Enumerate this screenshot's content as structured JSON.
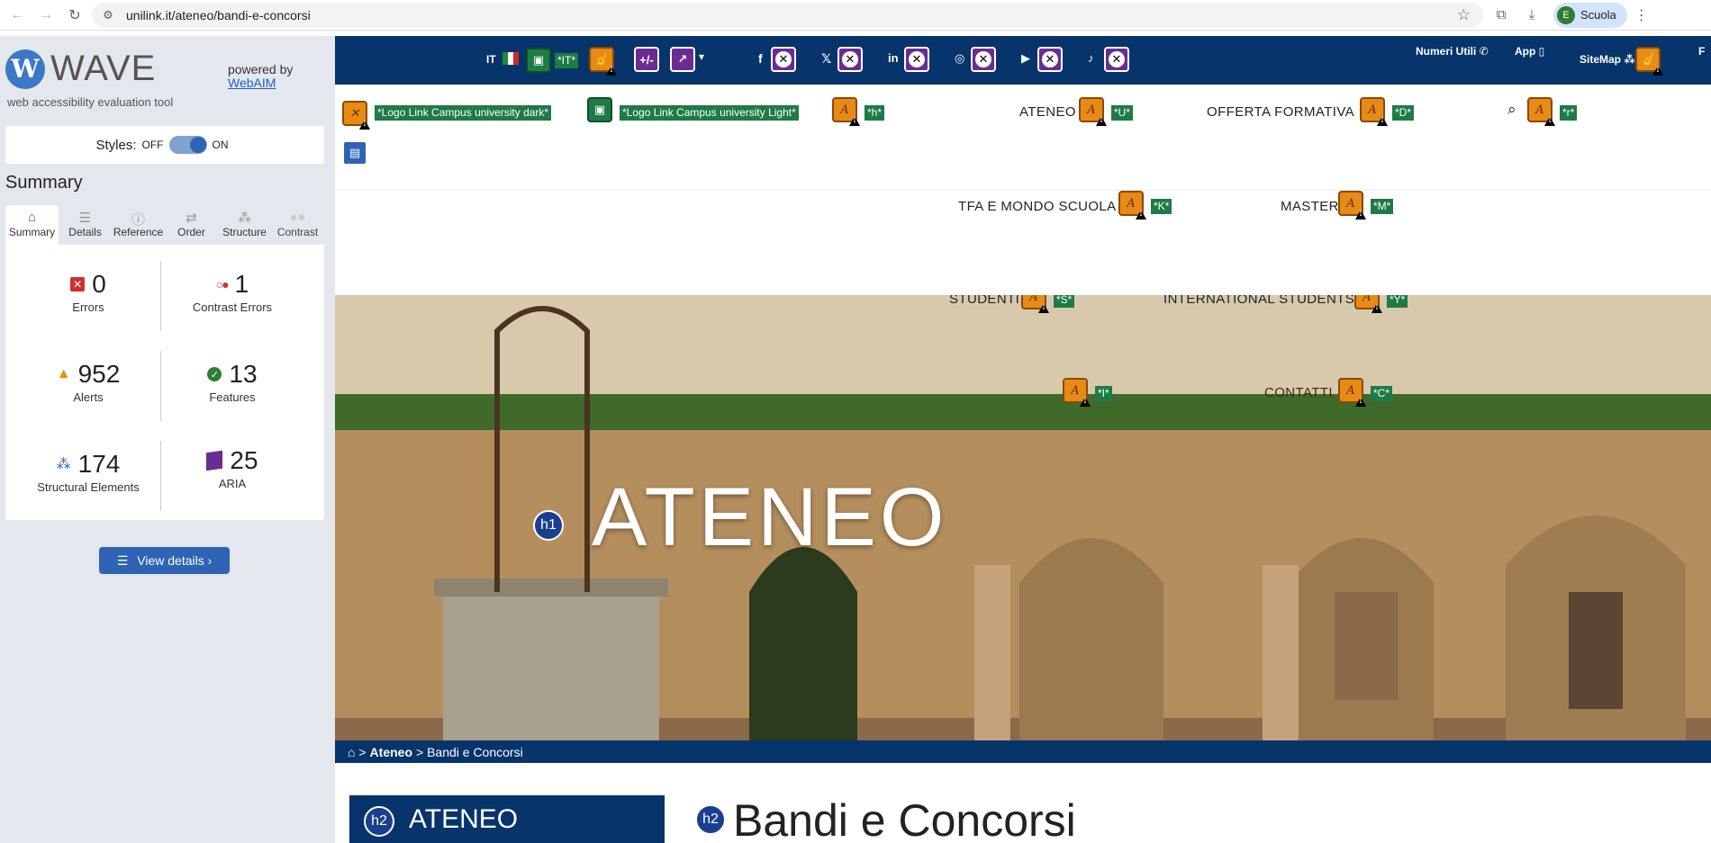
{
  "browser": {
    "url": "unilink.it/ateneo/bandi-e-concorsi",
    "profile_initial": "E",
    "profile_name": "Scuola"
  },
  "wave": {
    "brand": "WAVE",
    "tagline": "web accessibility evaluation tool",
    "powered_by": "powered by",
    "powered_link": "WebAIM",
    "styles_label": "Styles:",
    "styles_off": "OFF",
    "styles_on": "ON",
    "summary_title": "Summary",
    "tabs": [
      {
        "label": "Summary",
        "icon": "home-icon"
      },
      {
        "label": "Details",
        "icon": "list-icon"
      },
      {
        "label": "Reference",
        "icon": "info-icon"
      },
      {
        "label": "Order",
        "icon": "order-icon"
      },
      {
        "label": "Structure",
        "icon": "structure-icon"
      },
      {
        "label": "Contrast",
        "icon": "contrast-icon"
      }
    ],
    "stats": {
      "errors": {
        "value": "0",
        "label": "Errors"
      },
      "contrast_errors": {
        "value": "1",
        "label": "Contrast Errors"
      },
      "alerts": {
        "value": "952",
        "label": "Alerts"
      },
      "features": {
        "value": "13",
        "label": "Features"
      },
      "structural": {
        "value": "174",
        "label": "Structural Elements"
      },
      "aria": {
        "value": "25",
        "label": "ARIA"
      }
    },
    "view_details": "View details ›"
  },
  "site": {
    "topbar": {
      "lang": "IT",
      "lang_tag": "*IT*",
      "numeri_utili": "Numeri Utili",
      "app": "App",
      "sitemap": "SiteMap",
      "cut_letter": "F"
    },
    "logo_dark": "*Logo Link Campus university dark*",
    "logo_light": "*Logo Link Campus university Light*",
    "tags": {
      "h": "*h*",
      "u": "*U*",
      "d": "*D*",
      "r": "*r*",
      "k": "*K*",
      "m": "*M*",
      "s": "*S*",
      "y": "*Y*",
      "i": "*I*",
      "c": "*C*"
    },
    "nav": {
      "ateneo": "ATENEO",
      "offerta": "OFFERTA FORMATIVA",
      "tfa": "TFA E MONDO SCUOLA",
      "master": "MASTER",
      "studenti": "STUDENTI",
      "international": "INTERNATIONAL STUDENTS",
      "contatti": "CONTATTI"
    },
    "hero_title": "ATENEO",
    "h1_badge": "h1",
    "h2_badge": "h2",
    "breadcrumb": {
      "sep": ">",
      "ateneo": "Ateneo",
      "current": "Bandi e Concorsi"
    },
    "sidebar_title": "ATENEO",
    "main_title": "Bandi e Concorsi"
  }
}
